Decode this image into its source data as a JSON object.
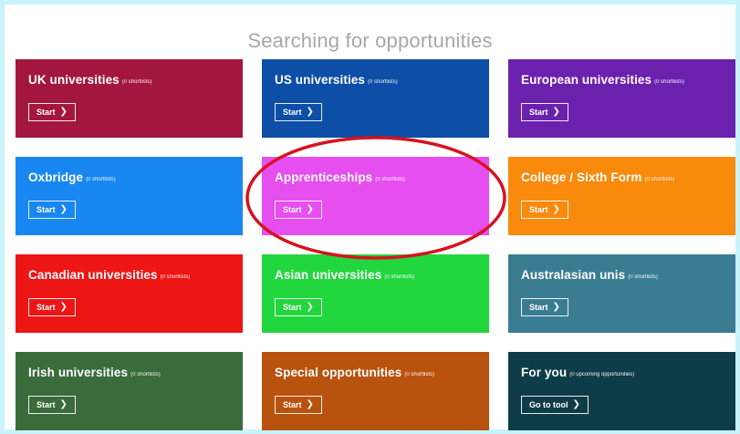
{
  "page": {
    "title": "Searching for opportunities"
  },
  "tiles": [
    {
      "title": "UK universities",
      "count": "(0 shortlists)",
      "button": "Start",
      "color": "#a3173f"
    },
    {
      "title": "US universities",
      "count": "(0 shortlists)",
      "button": "Start",
      "color": "#0d4ea6"
    },
    {
      "title": "European universities",
      "count": "(0 shortlists)",
      "button": "Start",
      "color": "#6b21ae"
    },
    {
      "title": "Oxbridge",
      "count": "(0 shortlists)",
      "button": "Start",
      "color": "#1887f2"
    },
    {
      "title": "Apprenticeships",
      "count": "(0 shortlists)",
      "button": "Start",
      "color": "#e64ef0"
    },
    {
      "title": "College / Sixth Form",
      "count": "(0 shortlists)",
      "button": "Start",
      "color": "#f98a0c"
    },
    {
      "title": "Canadian universities",
      "count": "(0 shortlists)",
      "button": "Start",
      "color": "#ee1515"
    },
    {
      "title": "Asian universities",
      "count": "(0 shortlists)",
      "button": "Start",
      "color": "#22d63e"
    },
    {
      "title": "Australasian unis",
      "count": "(0 shortlists)",
      "button": "Start",
      "color": "#3a7d93"
    },
    {
      "title": "Irish universities",
      "count": "(0 shortlists)",
      "button": "Start",
      "color": "#396b3b"
    },
    {
      "title": "Special opportunities",
      "count": "(0 shortlists)",
      "button": "Start",
      "color": "#b8520e"
    },
    {
      "title": "For you",
      "count": "(0 upcoming opportunities)",
      "button": "Go to tool",
      "color": "#0e3d49"
    }
  ],
  "annotation": {
    "color": "#d6131f"
  },
  "icons": {
    "button_chevron": "chevron-right-icon"
  }
}
